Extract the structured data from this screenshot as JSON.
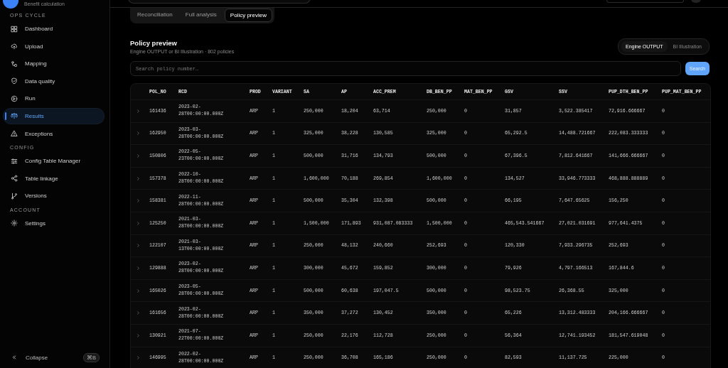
{
  "sidebar": {
    "app_subtitle": "Benefit calculation",
    "sections": [
      {
        "title": "OPS CYCLE",
        "items": [
          {
            "label": "Dashboard",
            "selected": false
          },
          {
            "label": "Upload",
            "selected": false
          },
          {
            "label": "Mapping",
            "selected": false
          },
          {
            "label": "Data quality",
            "selected": false
          },
          {
            "label": "Run",
            "selected": false
          },
          {
            "label": "Results",
            "selected": true
          },
          {
            "label": "Exceptions",
            "selected": false
          }
        ]
      },
      {
        "title": "CONFIG",
        "items": [
          {
            "label": "Config Table Manager",
            "selected": false
          },
          {
            "label": "Table linkage",
            "selected": false
          },
          {
            "label": "Versions",
            "selected": false
          }
        ]
      },
      {
        "title": "ACCOUNT",
        "items": [
          {
            "label": "Settings",
            "selected": false
          }
        ]
      }
    ],
    "collapse": {
      "label": "Collapse",
      "shortcut": "⌘B"
    }
  },
  "tabs": [
    {
      "label": "Reconciliation",
      "selected": false
    },
    {
      "label": "Full analysis",
      "selected": false
    },
    {
      "label": "Policy preview",
      "selected": true
    }
  ],
  "panel": {
    "title": "Policy preview",
    "subtitle": "Engine OUTPUT or BI Illustration · 802 policies",
    "source_toggle": [
      {
        "label": "Engine OUTPUT",
        "selected": true
      },
      {
        "label": "BI Illustration",
        "selected": false
      }
    ],
    "search": {
      "placeholder": "Search policy number…",
      "button": "Search"
    }
  },
  "table": {
    "columns": [
      "POL_NO",
      "RCD",
      "PROD",
      "VARIANT",
      "SA",
      "AP",
      "ACC_PREM",
      "DB_BEN_PP",
      "MAT_BEN_PP",
      "GSV",
      "SSV",
      "PUP_DTH_BEN_PP",
      "PUP_MAT_BEN_PP"
    ],
    "rows": [
      [
        "161436",
        "2023-02-28T00:00:00.000Z",
        "ARP",
        "1",
        "250,000",
        "18,204",
        "63,714",
        "250,000",
        "0",
        "31,857",
        "3,522.385417",
        "72,916.666667",
        "0"
      ],
      [
        "162950",
        "2023-03-28T00:00:00.000Z",
        "ARP",
        "1",
        "325,000",
        "38,228",
        "130,585",
        "325,000",
        "0",
        "65,292.5",
        "14,488.721667",
        "222,083.333333",
        "0"
      ],
      [
        "150806",
        "2022-05-23T00:00:00.000Z",
        "ARP",
        "1",
        "500,000",
        "31,716",
        "134,793",
        "500,000",
        "0",
        "67,396.5",
        "7,812.641667",
        "141,666.666667",
        "0"
      ],
      [
        "157378",
        "2022-10-28T00:00:00.000Z",
        "ARP",
        "1",
        "1,600,000",
        "70,188",
        "269,854",
        "1,600,000",
        "0",
        "134,527",
        "33,946.773333",
        "468,888.888889",
        "0"
      ],
      [
        "158381",
        "2022-11-28T00:00:00.000Z",
        "ARP",
        "1",
        "500,000",
        "35,304",
        "132,398",
        "500,000",
        "0",
        "66,195",
        "7,647.65625",
        "156,250",
        "0"
      ],
      [
        "125250",
        "2021-03-28T00:00:00.000Z",
        "ARP",
        "1",
        "1,500,000",
        "171,893",
        "931,087.083333",
        "1,500,000",
        "0",
        "465,543.541667",
        "27,021.031691",
        "977,641.4375",
        "0"
      ],
      [
        "122107",
        "2021-03-13T00:00:00.000Z",
        "ARP",
        "1",
        "250,000",
        "48,132",
        "240,660",
        "252,693",
        "0",
        "120,330",
        "7,933.296735",
        "252,693",
        "0"
      ],
      [
        "129888",
        "2023-02-28T00:00:00.000Z",
        "ARP",
        "1",
        "300,000",
        "45,672",
        "159,852",
        "300,000",
        "0",
        "79,926",
        "4,797.166513",
        "167,844.6",
        "0"
      ],
      [
        "165026",
        "2023-05-28T00:00:00.000Z",
        "ARP",
        "1",
        "500,000",
        "60,638",
        "197,047.5",
        "500,000",
        "0",
        "98,523.75",
        "26,368.55",
        "325,000",
        "0"
      ],
      [
        "161656",
        "2023-02-28T00:00:00.000Z",
        "ARP",
        "1",
        "350,000",
        "37,272",
        "130,452",
        "350,000",
        "0",
        "65,226",
        "13,312.483333",
        "204,166.666667",
        "0"
      ],
      [
        "130921",
        "2021-07-22T00:00:00.000Z",
        "ARP",
        "1",
        "250,000",
        "22,176",
        "112,728",
        "250,000",
        "0",
        "56,364",
        "12,741.193452",
        "181,547.619048",
        "0"
      ],
      [
        "146995",
        "2022-02-28T00:00:00.000Z",
        "ARP",
        "1",
        "250,000",
        "36,708",
        "165,186",
        "250,000",
        "0",
        "82,593",
        "11,137.725",
        "225,000",
        "0"
      ]
    ]
  }
}
